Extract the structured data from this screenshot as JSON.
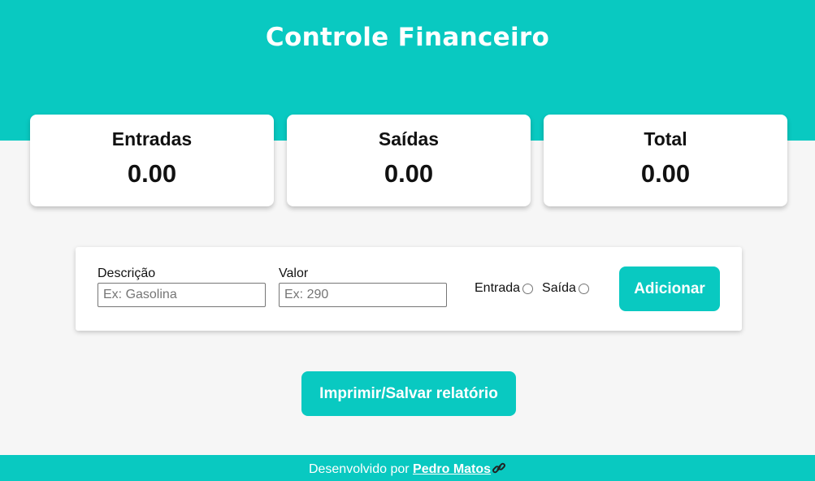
{
  "header": {
    "title": "Controle Financeiro"
  },
  "summary": {
    "entradas": {
      "label": "Entradas",
      "value": "0.00"
    },
    "saidas": {
      "label": "Saídas",
      "value": "0.00"
    },
    "total": {
      "label": "Total",
      "value": "0.00"
    }
  },
  "form": {
    "descricao": {
      "label": "Descrição",
      "placeholder": "Ex: Gasolina",
      "value": ""
    },
    "valor": {
      "label": "Valor",
      "placeholder": "Ex: 290",
      "value": ""
    },
    "tipo": {
      "options": [
        {
          "label": "Entrada",
          "checked": false
        },
        {
          "label": "Saída",
          "checked": false
        }
      ]
    },
    "add_label": "Adicionar"
  },
  "report_label": "Imprimir/Salvar relatório",
  "footer": {
    "text": "Desenvolvido por",
    "link_text": "Pedro Matos",
    "link_icon": "link-icon"
  },
  "colors": {
    "accent": "#09c9c1",
    "background": "#f6f6f6"
  }
}
